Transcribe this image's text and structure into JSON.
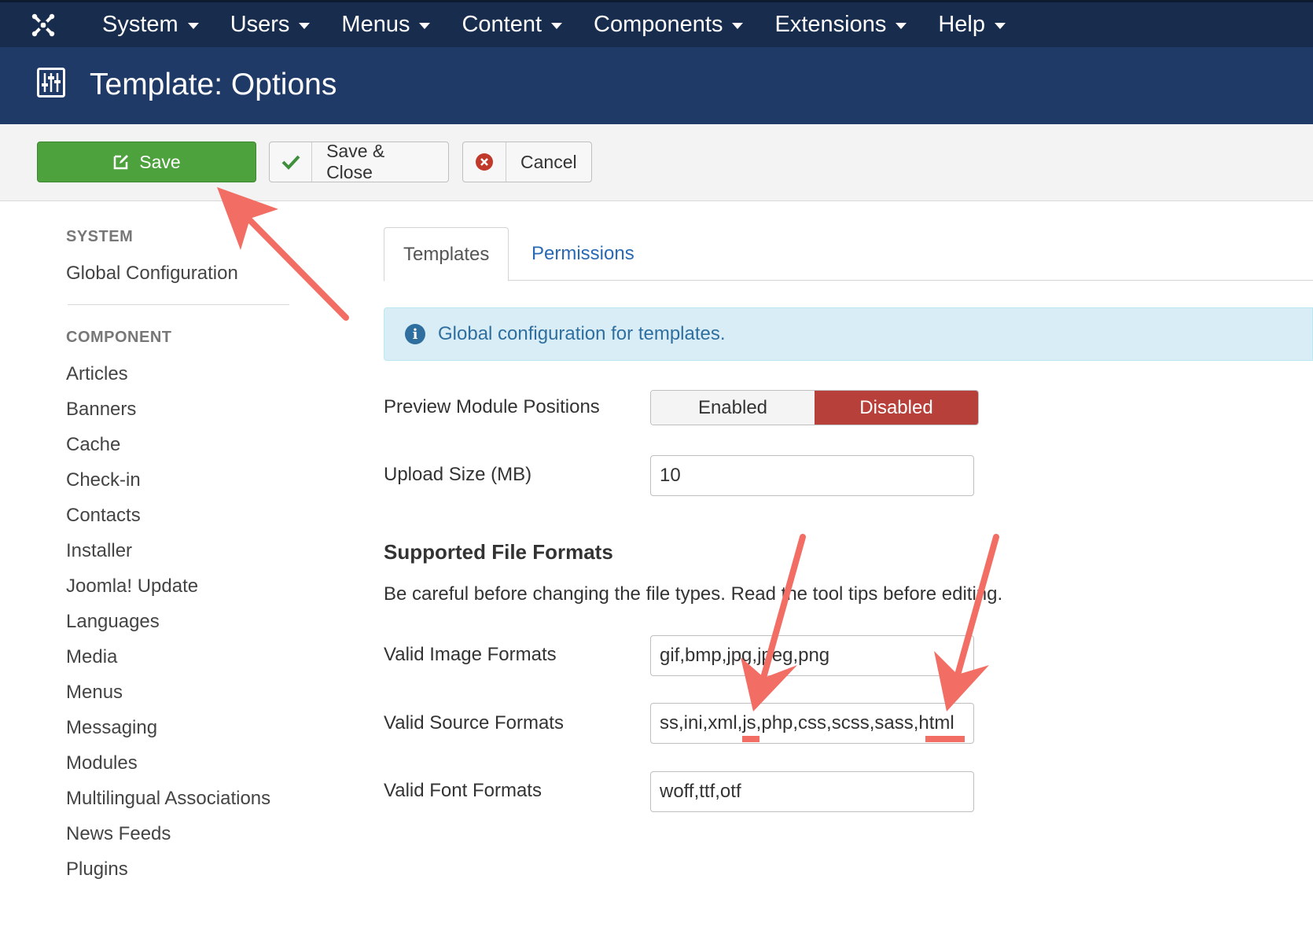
{
  "nav": {
    "items": [
      "System",
      "Users",
      "Menus",
      "Content",
      "Components",
      "Extensions",
      "Help"
    ]
  },
  "header": {
    "title": "Template: Options"
  },
  "toolbar": {
    "save_label": "Save",
    "save_close_label": "Save & Close",
    "cancel_label": "Cancel"
  },
  "sidebar": {
    "system_heading": "SYSTEM",
    "system_items": [
      "Global Configuration"
    ],
    "component_heading": "COMPONENT",
    "component_items": [
      "Articles",
      "Banners",
      "Cache",
      "Check-in",
      "Contacts",
      "Installer",
      "Joomla! Update",
      "Languages",
      "Media",
      "Menus",
      "Messaging",
      "Modules",
      "Multilingual Associations",
      "News Feeds",
      "Plugins"
    ]
  },
  "tabs": [
    "Templates",
    "Permissions"
  ],
  "alert": {
    "text": "Global configuration for templates."
  },
  "form": {
    "preview_label": "Preview Module Positions",
    "preview_enabled": "Enabled",
    "preview_disabled": "Disabled",
    "upload_label": "Upload Size (MB)",
    "upload_value": "10",
    "section_title": "Supported File Formats",
    "section_desc": "Be careful before changing the file types. Read the tool tips before editing.",
    "image_label": "Valid Image Formats",
    "image_value": "gif,bmp,jpg,jpeg,png",
    "source_label": "Valid Source Formats",
    "source_value": "ss,ini,xml,js,php,css,scss,sass,html",
    "font_label": "Valid Font Formats",
    "font_value": "woff,ttf,otf"
  },
  "colors": {
    "nav_bg": "#182d4d",
    "header_bg": "#1f3a66",
    "save_green": "#4ea23d",
    "disabled_red": "#b8403a",
    "annotation": "#f26d63",
    "link_blue": "#2a69b3"
  }
}
